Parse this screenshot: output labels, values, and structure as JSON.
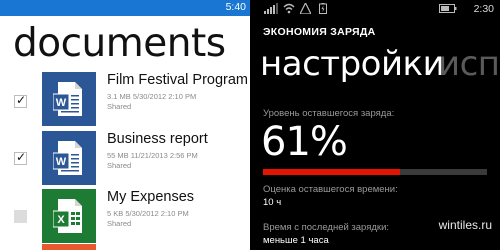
{
  "left_phone": {
    "status_time": "5:40",
    "title": "documents",
    "documents": [
      {
        "name": "Film Festival Program",
        "meta": "3.1 MB  5/30/2012 2:10 PM",
        "status": "Shared",
        "type": "word",
        "checked": true
      },
      {
        "name": "Business report",
        "meta": "55 MB  11/21/2013  2:56 PM",
        "status": "Shared",
        "type": "word",
        "checked": true
      },
      {
        "name": "My Expenses",
        "meta": "5 KB  5/30/2012 2:10 PM",
        "status": "Shared",
        "type": "excel",
        "checked": false
      }
    ],
    "colors": {
      "status_bar": "#1976d2",
      "word_tile": "#2b5797",
      "excel_tile": "#1e7b34",
      "partial_tile": "#e8592f"
    }
  },
  "right_phone": {
    "status_time": "2:30",
    "app_name": "ЭКОНОМИЯ ЗАРЯДА",
    "pivot_active": "настройки",
    "pivot_next": "испо",
    "battery_label": "Уровень оставшегося заряда:",
    "battery_percent": "61%",
    "battery_level": 0.61,
    "estimate_label": "Оценка оставшегося времени:",
    "estimate_value": "10 ч",
    "since_charge_label": "Время с последней зарядки:",
    "since_charge_value": "меньше 1 часа",
    "watermark": "wintiles.ru",
    "colors": {
      "bar_fill": "#e51400",
      "bar_track": "#3a3a3a"
    }
  }
}
